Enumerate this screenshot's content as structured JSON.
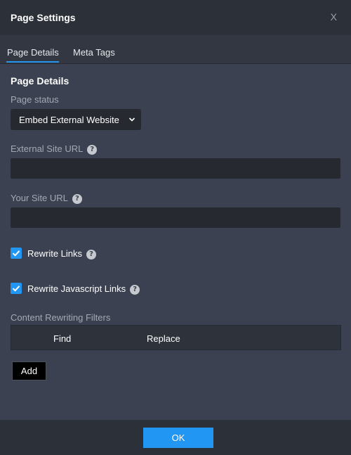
{
  "dialog": {
    "title": "Page Settings",
    "close_label": "X"
  },
  "tabs": [
    {
      "label": "Page Details",
      "active": true
    },
    {
      "label": "Meta Tags",
      "active": false
    }
  ],
  "section": {
    "title": "Page Details"
  },
  "page_status": {
    "label": "Page status",
    "selected": "Embed External Website"
  },
  "external_site_url": {
    "label": "External Site URL",
    "value": ""
  },
  "your_site_url": {
    "label": "Your Site URL",
    "value": ""
  },
  "rewrite_links": {
    "label": "Rewrite Links",
    "checked": true
  },
  "rewrite_js_links": {
    "label": "Rewrite Javascript Links",
    "checked": true
  },
  "filters": {
    "label": "Content Rewriting Filters",
    "columns": [
      "Find",
      "Replace"
    ],
    "add_label": "Add"
  },
  "footer": {
    "ok_label": "OK"
  },
  "icons": {
    "help": "question-circle-icon",
    "check": "check-icon",
    "chevron": "chevron-down-icon"
  },
  "colors": {
    "accent": "#2196f3",
    "background": "#3b4150",
    "header": "#2c3038",
    "input": "#262a30"
  }
}
